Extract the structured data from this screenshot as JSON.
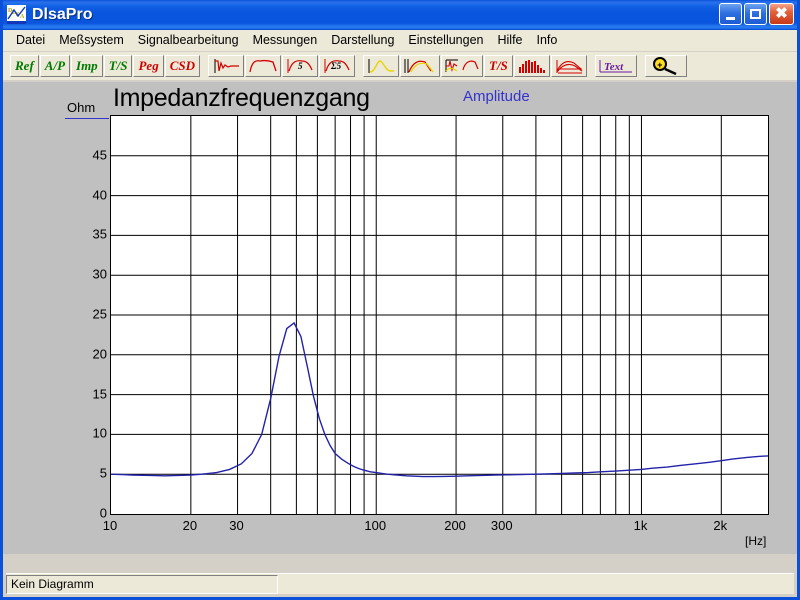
{
  "window": {
    "title": "DlsaPro",
    "logo_icon": "dlsa-logo-icon",
    "minimize_label": "Minimize",
    "maximize_label": "Maximize",
    "close_label": "Close"
  },
  "menubar": {
    "items": [
      {
        "label": "Datei"
      },
      {
        "label": "Meßsystem"
      },
      {
        "label": "Signalbearbeitung"
      },
      {
        "label": "Messungen"
      },
      {
        "label": "Darstellung"
      },
      {
        "label": "Einstellungen"
      },
      {
        "label": "Hilfe"
      },
      {
        "label": "Info"
      }
    ]
  },
  "toolbar": {
    "text_buttons": [
      {
        "label": "Ref",
        "color": "#007a00",
        "name": "ref-button"
      },
      {
        "label": "A/P",
        "color": "#007a00",
        "name": "ap-button"
      },
      {
        "label": "Imp",
        "color": "#007a00",
        "name": "imp-button"
      },
      {
        "label": "T/S",
        "color": "#007a00",
        "name": "ts-button"
      },
      {
        "label": "Peg",
        "color": "#cc0000",
        "name": "peg-button"
      },
      {
        "label": "CSD",
        "color": "#cc0000",
        "name": "csd-button"
      }
    ],
    "icon_buttons": [
      {
        "name": "impulse-response-icon",
        "title": "Impulsantwort"
      },
      {
        "name": "frequency-response-icon",
        "title": "Frequenzgang"
      },
      {
        "name": "smoothing-5-icon",
        "title": "Glättung 5"
      },
      {
        "name": "sum-smoothing-5-icon",
        "title": "Summe 5"
      },
      {
        "name": "single-curve-yellow-icon",
        "title": "Einzelkurve"
      },
      {
        "name": "multi-curve-icon",
        "title": "Mehrfachkurve"
      },
      {
        "name": "impulse-and-response-icon",
        "title": "Impuls und Frequenzgang"
      },
      {
        "name": "ts-parameters-icon",
        "title": "T/S Parameter"
      },
      {
        "name": "bar-spectrum-icon",
        "title": "Terzspektrum"
      },
      {
        "name": "waterfall-icon",
        "title": "Wasserfall"
      },
      {
        "name": "text-icon",
        "title": "Text"
      },
      {
        "name": "zoom-icon",
        "title": "Zoom"
      }
    ],
    "text_labels": {
      "ts_italic": "T/S",
      "text_button": "Text"
    }
  },
  "chart_data": {
    "type": "line",
    "title": "Impedanzfrequenzgang",
    "legend": [
      "Amplitude"
    ],
    "legend_position": "top-center",
    "legend_color": "#3333cc",
    "series_color": "#2222aa",
    "xlabel": "[Hz]",
    "ylabel": "Ohm",
    "xscale": "log",
    "xlim": [
      10,
      3000
    ],
    "ylim": [
      0,
      50
    ],
    "grid": true,
    "xticks": [
      10,
      20,
      30,
      100,
      200,
      300,
      1000,
      2000
    ],
    "xtick_labels": [
      "10",
      "20",
      "30",
      "100",
      "200",
      "300",
      "1k",
      "2k"
    ],
    "yticks": [
      0,
      5,
      10,
      15,
      20,
      25,
      30,
      35,
      40,
      45
    ],
    "ytick_labels": [
      "0",
      "5",
      "10",
      "15",
      "20",
      "25",
      "30",
      "35",
      "40",
      "45"
    ],
    "x": [
      10,
      12,
      14,
      16,
      18,
      20,
      22,
      25,
      28,
      31,
      34,
      37,
      40,
      43,
      46,
      49,
      52,
      55,
      58,
      61,
      64,
      67,
      70,
      74,
      78,
      82,
      86,
      90,
      95,
      100,
      110,
      120,
      130,
      140,
      150,
      165,
      180,
      200,
      220,
      250,
      280,
      310,
      350,
      400,
      450,
      500,
      560,
      630,
      700,
      800,
      900,
      1000,
      1100,
      1250,
      1400,
      1600,
      1800,
      2000,
      2200,
      2500,
      2800,
      3000
    ],
    "y": [
      5.0,
      4.9,
      4.85,
      4.8,
      4.85,
      4.9,
      5.0,
      5.2,
      5.6,
      6.3,
      7.6,
      10.0,
      14.5,
      19.8,
      23.3,
      24.0,
      22.3,
      18.5,
      14.8,
      12.0,
      10.0,
      8.6,
      7.6,
      6.9,
      6.4,
      6.0,
      5.7,
      5.5,
      5.3,
      5.2,
      5.0,
      4.9,
      4.8,
      4.75,
      4.7,
      4.7,
      4.72,
      4.75,
      4.8,
      4.85,
      4.9,
      4.92,
      4.95,
      5.0,
      5.05,
      5.1,
      5.15,
      5.2,
      5.3,
      5.4,
      5.5,
      5.6,
      5.75,
      5.9,
      6.1,
      6.3,
      6.5,
      6.7,
      6.9,
      7.1,
      7.25,
      7.3
    ],
    "annotations": {
      "resonance_peak_ohm": 24.0,
      "resonance_freq_hz": 49,
      "dc_resistance_ohm": 4.7
    }
  },
  "statusbar": {
    "message": "Kein Diagramm"
  }
}
